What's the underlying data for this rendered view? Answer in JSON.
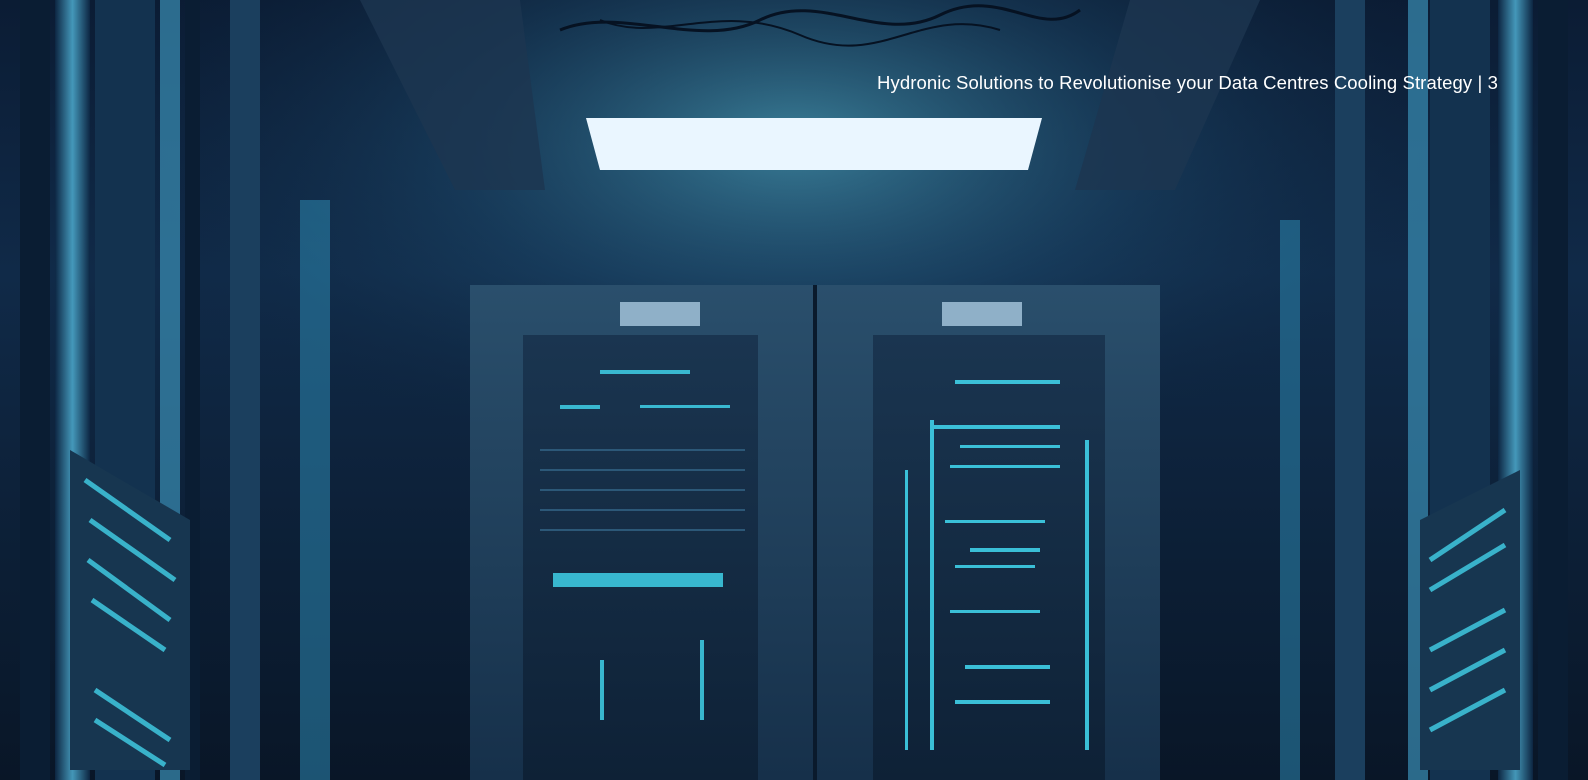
{
  "header": {
    "title": "Hydronic Solutions to Revolutionise your Data Centres Cooling Strategy",
    "separator": "|",
    "page_number": "3"
  },
  "background": {
    "subject": "server-room-photo",
    "colors": {
      "dark": "#0a1a30",
      "mid": "#143a5c",
      "accent": "#3fd0e8"
    }
  }
}
